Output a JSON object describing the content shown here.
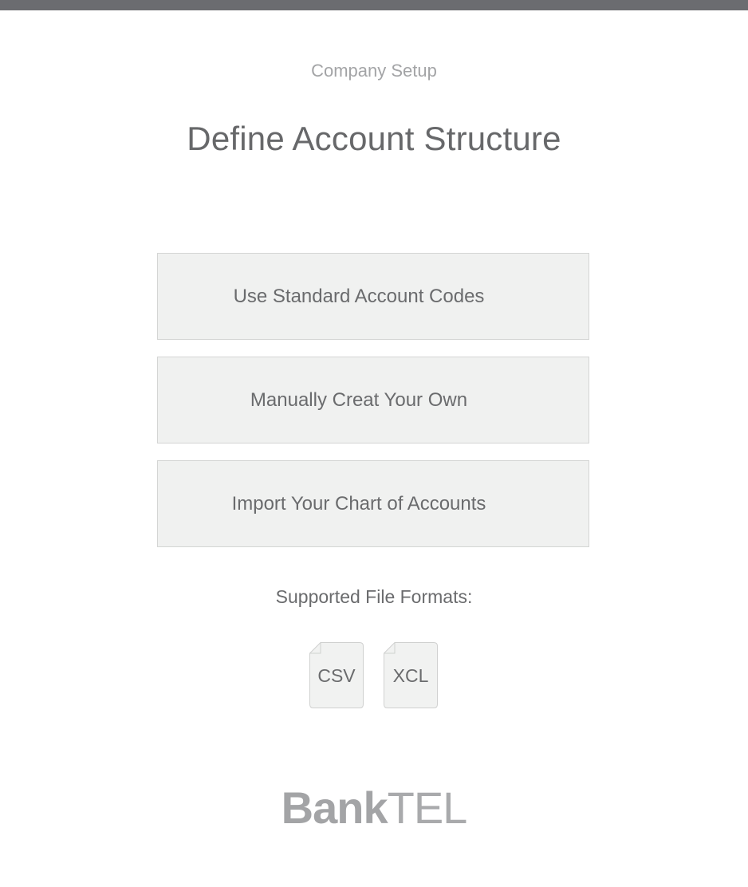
{
  "header": {
    "eyebrow": "Company Setup",
    "title": "Define Account Structure"
  },
  "options": [
    {
      "label": "Use Standard Account Codes"
    },
    {
      "label": "Manually Creat Your Own"
    },
    {
      "label": "Import Your Chart of Accounts"
    }
  ],
  "formats": {
    "label": "Supported File Formats:",
    "items": [
      {
        "label": "CSV",
        "icon": "file-icon"
      },
      {
        "label": "XCL",
        "icon": "file-icon"
      }
    ]
  },
  "brand": {
    "bold": "Bank",
    "light": "TEL"
  },
  "colors": {
    "top_bar": "#6b6c70",
    "option_bg": "#f0f1f0",
    "text": "#6a6b6d",
    "muted": "#a3a4a6"
  }
}
